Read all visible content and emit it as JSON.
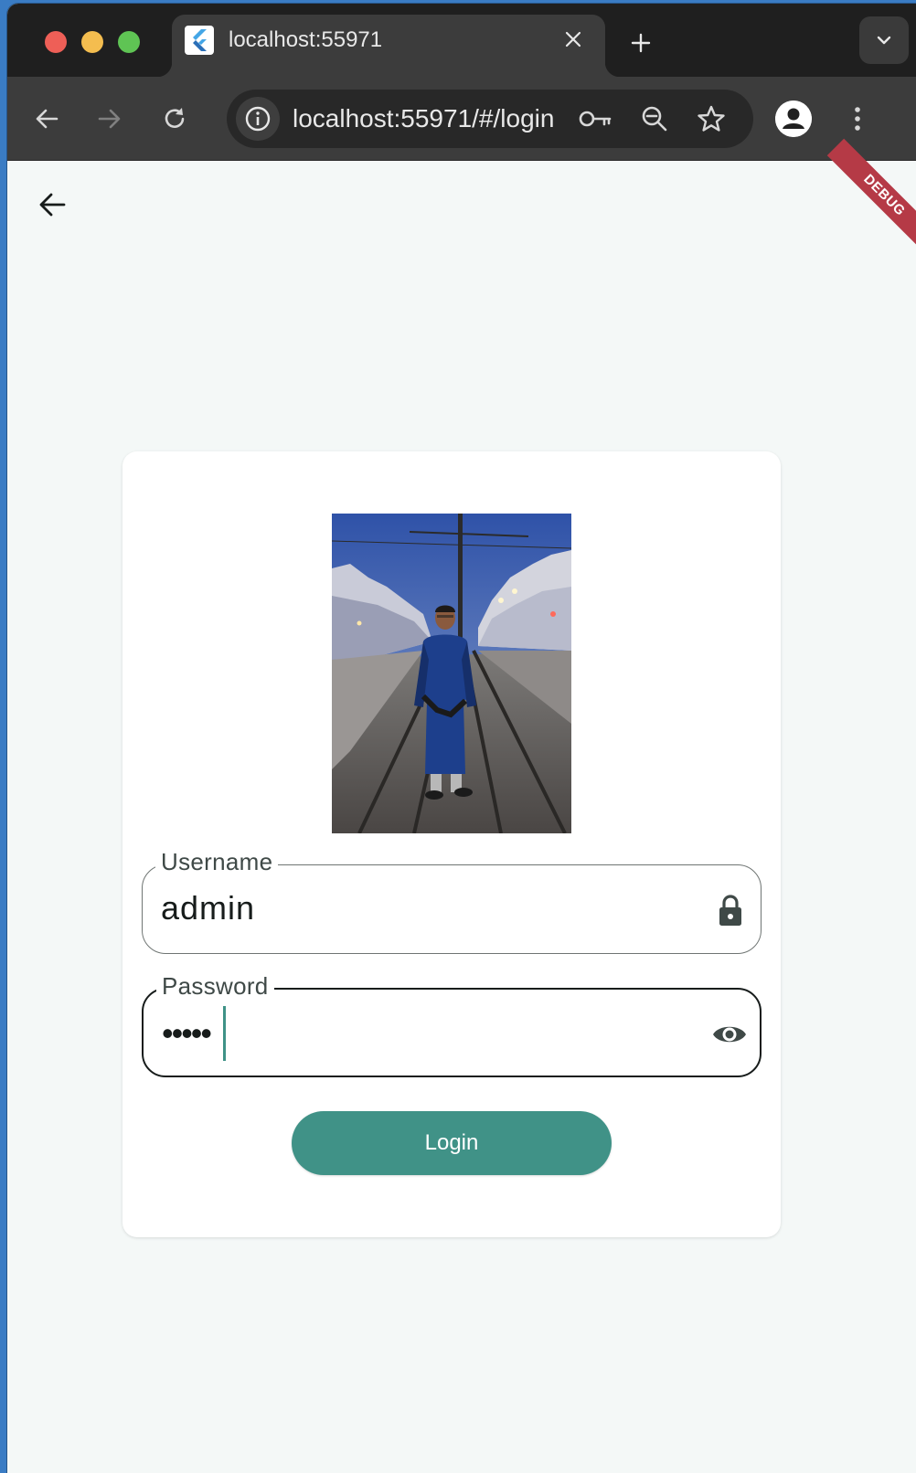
{
  "browser": {
    "tab_title": "localhost:55971",
    "url": "localhost:55971/#/login"
  },
  "app": {
    "debug_banner": "DEBUG",
    "profile_image_alt": "Person standing on tram tracks in a city street at dusk",
    "username": {
      "label": "Username",
      "value": "admin"
    },
    "password": {
      "label": "Password",
      "masked_value": "•••••"
    },
    "login_button": "Login"
  },
  "colors": {
    "primary": "#409287",
    "background": "#f4f8f7",
    "debug_banner": "#b53a46",
    "browser_chrome": "#3c3c3c"
  }
}
